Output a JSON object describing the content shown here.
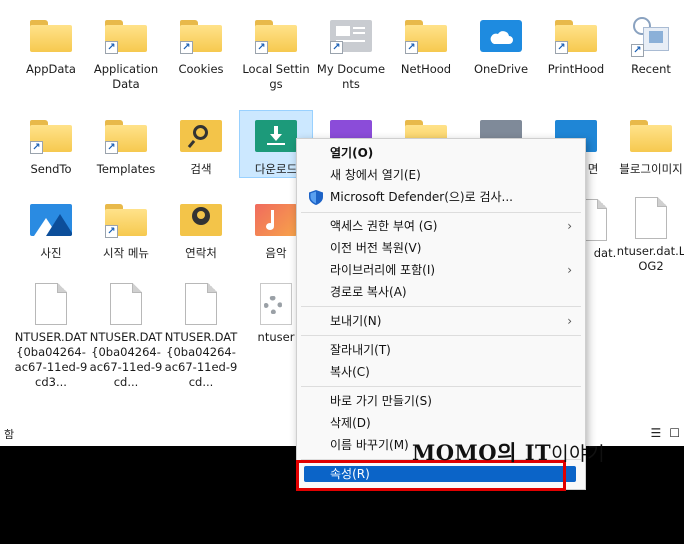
{
  "items": [
    {
      "label": "AppData",
      "kind": "folder",
      "shortcut": false
    },
    {
      "label": "Application Data",
      "kind": "folder",
      "shortcut": true
    },
    {
      "label": "Cookies",
      "kind": "folder",
      "shortcut": true
    },
    {
      "label": "Local Settings",
      "kind": "folder",
      "shortcut": true
    },
    {
      "label": "My Documents",
      "kind": "mydocs",
      "shortcut": true
    },
    {
      "label": "NetHood",
      "kind": "folder",
      "shortcut": true
    },
    {
      "label": "OneDrive",
      "kind": "onedrive",
      "shortcut": false
    },
    {
      "label": "PrintHood",
      "kind": "folder",
      "shortcut": true
    },
    {
      "label": "Recent",
      "kind": "recent",
      "shortcut": true
    },
    {
      "label": "SendTo",
      "kind": "folder",
      "shortcut": true
    },
    {
      "label": "Templates",
      "kind": "folder",
      "shortcut": true
    },
    {
      "label": "검색",
      "kind": "search",
      "shortcut": false
    },
    {
      "label": "다운로드",
      "kind": "downloads",
      "shortcut": false,
      "selected": true
    },
    {
      "label": "면",
      "kind": "folder-blue",
      "shortcut": false
    },
    {
      "label": "블로그이미지",
      "kind": "folder",
      "shortcut": false
    },
    {
      "label": "사진",
      "kind": "pictures",
      "shortcut": false
    },
    {
      "label": "시작 메뉴",
      "kind": "folder",
      "shortcut": true
    },
    {
      "label": "연락처",
      "kind": "contacts",
      "shortcut": false
    },
    {
      "label": "음악",
      "kind": "music",
      "shortcut": false
    },
    {
      "label": "dat.",
      "kind": "doc",
      "shortcut": false
    },
    {
      "label": "ntuser.dat.LOG2",
      "kind": "doc",
      "shortcut": false
    },
    {
      "label": "NTUSER.DAT{0ba04264-ac67-11ed-9cd3...",
      "kind": "doc",
      "shortcut": false
    },
    {
      "label": "NTUSER.DAT{0ba04264-ac67-11ed-9cd...",
      "kind": "doc",
      "shortcut": false
    },
    {
      "label": "NTUSER.DAT{0ba04264-ac67-11ed-9cd...",
      "kind": "doc",
      "shortcut": false
    },
    {
      "label": "ntuser",
      "kind": "gear",
      "shortcut": false
    }
  ],
  "status": {
    "left": "함"
  },
  "menu": {
    "open": "열기(O)",
    "open_new_window": "새 창에서 열기(E)",
    "defender": "Microsoft Defender(으)로 검사...",
    "give_access": "액세스 권한 부여 (G)",
    "restore_prev": "이전 버전 복원(V)",
    "include_library": "라이브러리에 포함(I)",
    "copy_path": "경로로 복사(A)",
    "send_to": "보내기(N)",
    "cut": "잘라내기(T)",
    "copy": "복사(C)",
    "create_shortcut": "바로 가기 만들기(S)",
    "delete": "삭제(D)",
    "rename": "이름 바꾸기(M)",
    "properties": "속성(R)"
  },
  "watermark": {
    "brand": "MOMO의 IT",
    "suffix": "이야기"
  },
  "colors": {
    "highlight": "#0b64c8",
    "redbox": "#e10000",
    "selection": "#cce8ff"
  }
}
